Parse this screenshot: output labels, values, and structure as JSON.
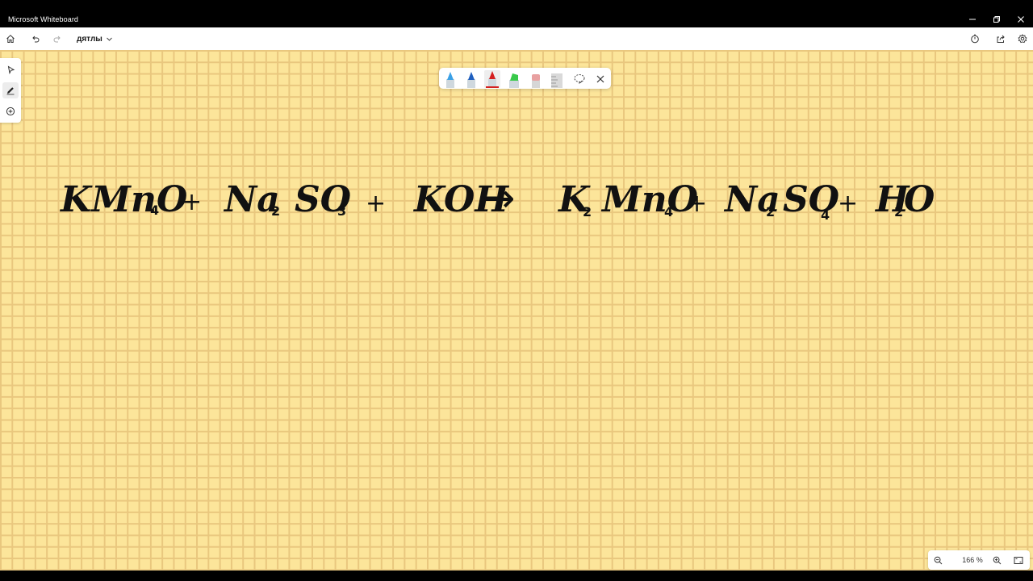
{
  "window": {
    "title": "Microsoft Whiteboard",
    "icons": {
      "minimize": "minimize-icon",
      "restore": "restore-icon",
      "close": "close-icon"
    }
  },
  "toolbar": {
    "board_name": "дятлы",
    "icons": [
      "home-icon",
      "undo-icon",
      "redo-icon",
      "chevron-down-icon",
      "timer-icon",
      "share-icon",
      "settings-icon"
    ]
  },
  "left_rail": {
    "tools": [
      {
        "name": "select",
        "icon": "cursor-icon",
        "active": false
      },
      {
        "name": "ink",
        "icon": "pen-icon",
        "active": true
      },
      {
        "name": "add",
        "icon": "add-circle-icon",
        "active": false
      }
    ]
  },
  "ink_tray": {
    "pens": [
      {
        "name": "light-blue-pen",
        "color": "#3aa0e6"
      },
      {
        "name": "blue-pen",
        "color": "#1f5fbf"
      },
      {
        "name": "red-pen",
        "color": "#d42020",
        "selected": true
      },
      {
        "name": "green-highlighter",
        "color": "#38c94a"
      },
      {
        "name": "eraser",
        "color": "#e8a0a0"
      },
      {
        "name": "ruler",
        "color": "#c8c8c8"
      }
    ],
    "icons": [
      "lasso-icon",
      "close-icon"
    ]
  },
  "canvas": {
    "background": "#fce59a",
    "grid_color": "#e9c77e",
    "ink_color": "#111111",
    "equation": {
      "terms": [
        {
          "text": "KMnO",
          "sub": "4"
        },
        {
          "text": "+"
        },
        {
          "text": "Na",
          "sub": "2"
        },
        {
          "text": "SO",
          "sub": "3"
        },
        {
          "text": "+"
        },
        {
          "text": "KOH"
        },
        {
          "text": "→"
        },
        {
          "text": "K",
          "sub": "2"
        },
        {
          "text": "MnO",
          "sub": "4"
        },
        {
          "text": "+"
        },
        {
          "text": "Na",
          "sub": "2"
        },
        {
          "text": "SO",
          "sub": "4"
        },
        {
          "text": "+"
        },
        {
          "text": "H",
          "sub": "2"
        },
        {
          "text": "O"
        }
      ]
    }
  },
  "zoom": {
    "value": "166 %",
    "icons": [
      "zoom-out-icon",
      "zoom-in-icon",
      "fit-to-screen-icon"
    ]
  }
}
